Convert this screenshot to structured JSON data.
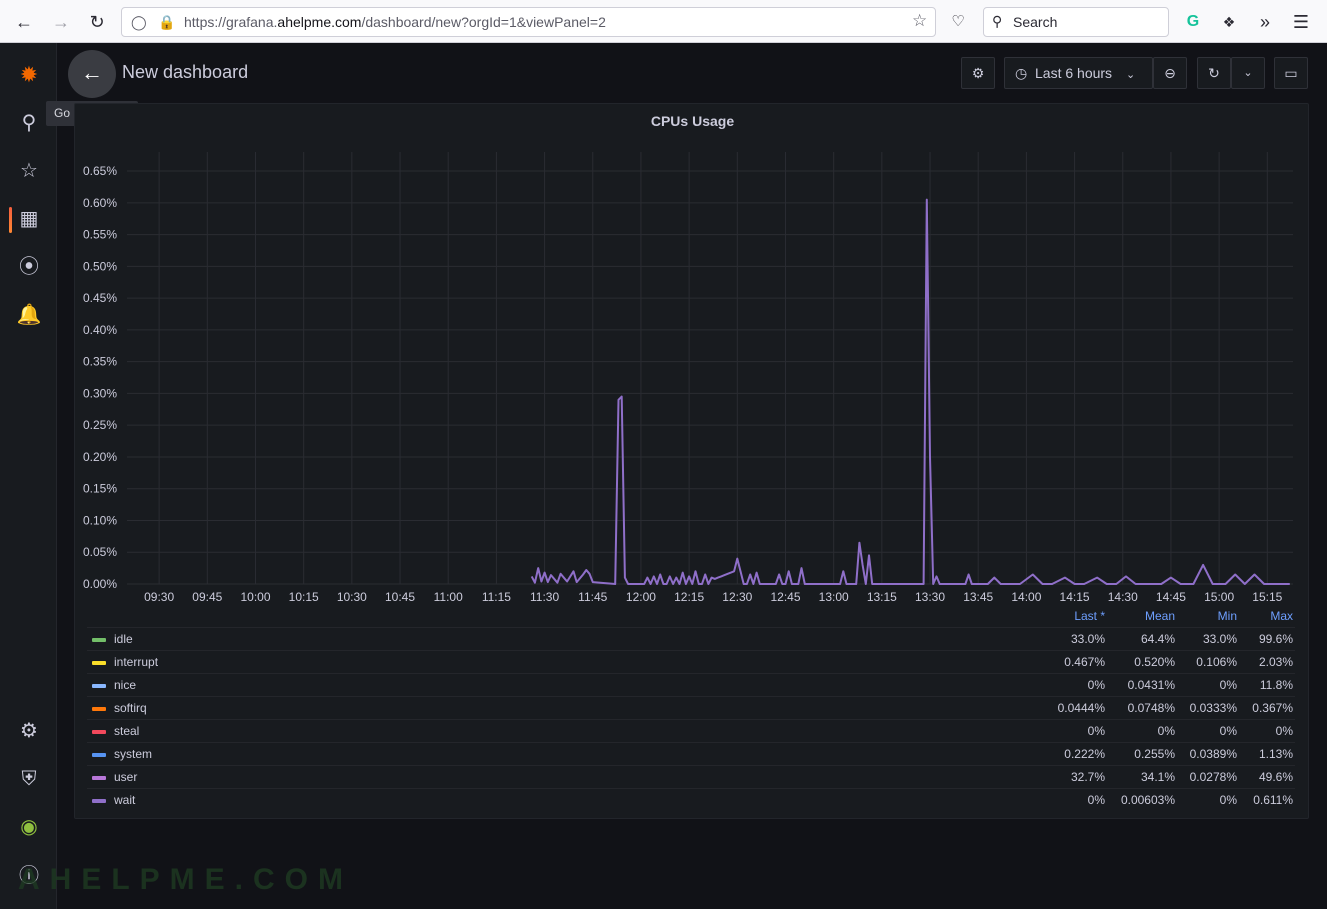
{
  "browser": {
    "url_prefix": "https://grafana.",
    "url_domain": "ahelpme.com",
    "url_suffix": "/dashboard/new?orgId=1&viewPanel=2",
    "search_label": "Search"
  },
  "header": {
    "title": "New dashboard",
    "back_tooltip": "Go back (Esc)",
    "time_range_label": "Last 6 hours"
  },
  "panel": {
    "title": "CPUs Usage"
  },
  "chart_data": {
    "type": "line",
    "title": "CPUs Usage",
    "x_ticks": [
      "09:30",
      "09:45",
      "10:00",
      "10:15",
      "10:30",
      "10:45",
      "11:00",
      "11:15",
      "11:30",
      "11:45",
      "12:00",
      "12:15",
      "12:30",
      "12:45",
      "13:00",
      "13:15",
      "13:30",
      "13:45",
      "14:00",
      "14:15",
      "14:30",
      "14:45",
      "15:00",
      "15:15"
    ],
    "y_ticks": [
      "0.00%",
      "0.05%",
      "0.10%",
      "0.15%",
      "0.20%",
      "0.25%",
      "0.30%",
      "0.35%",
      "0.40%",
      "0.45%",
      "0.50%",
      "0.55%",
      "0.60%",
      "0.65%"
    ],
    "ylim": [
      0,
      0.68
    ],
    "xlim_minutes": [
      560,
      923
    ],
    "grid": true,
    "series_color": "#8f6fc9",
    "series": [
      {
        "name": "wait",
        "x_minutes": [
          686,
          687,
          688,
          689,
          690,
          691,
          692,
          694,
          695,
          697,
          699,
          700,
          702,
          703,
          704,
          705,
          712,
          713,
          714,
          715,
          716,
          721,
          722,
          723,
          724,
          725,
          726,
          727,
          728,
          729,
          730,
          731,
          732,
          733,
          734,
          735,
          736,
          737,
          738,
          739,
          740,
          741,
          742,
          743,
          744,
          745,
          746,
          747,
          748,
          749,
          750,
          751,
          752,
          753,
          754,
          755,
          756,
          757,
          762,
          763,
          764,
          765,
          766,
          767,
          768,
          769,
          770,
          771,
          772,
          773,
          774,
          775,
          776,
          777,
          778,
          779,
          780,
          781,
          782,
          783,
          784,
          785,
          786,
          787,
          788,
          789,
          790,
          791,
          792,
          793,
          797,
          798,
          799,
          800,
          801,
          802,
          803,
          804,
          805,
          807,
          808,
          809,
          810,
          811,
          812,
          813,
          814,
          815,
          816,
          817,
          818,
          820,
          821,
          822,
          823,
          824,
          825,
          826,
          828,
          830,
          832,
          835,
          838,
          842,
          845,
          848,
          852,
          855,
          858,
          862,
          865,
          868,
          871,
          874,
          878,
          882,
          885,
          888,
          892,
          895,
          898,
          902,
          905,
          908,
          911,
          914,
          918,
          921,
          922
        ],
        "values": [
          0.012,
          0.002,
          0.025,
          0.004,
          0.018,
          0.003,
          0.014,
          0.002,
          0.016,
          0.004,
          0.02,
          0.003,
          0.015,
          0.022,
          0.016,
          0.003,
          0.0,
          0.29,
          0.295,
          0.01,
          0.0,
          0.0,
          0.01,
          0.0,
          0.012,
          0.0,
          0.015,
          0.0,
          0.0,
          0.012,
          0.0,
          0.01,
          0.0,
          0.018,
          0.0,
          0.012,
          0.0,
          0.02,
          0.0,
          0.0,
          0.015,
          0.0,
          0.01,
          0.008,
          0.01,
          0.012,
          0.014,
          0.016,
          0.018,
          0.02,
          0.04,
          0.02,
          0.0,
          0.0,
          0.015,
          0.0,
          0.018,
          0.0,
          0.0,
          0.015,
          0.0,
          0.0,
          0.02,
          0.0,
          0.0,
          0.0,
          0.025,
          0.0,
          0.0,
          0.0,
          0.0,
          0.0,
          0.0,
          0.0,
          0.0,
          0.0,
          0.0,
          0.0,
          0.0,
          0.02,
          0.0,
          0.0,
          0.0,
          0.0,
          0.065,
          0.03,
          0.0,
          0.045,
          0.0,
          0.0,
          0.0,
          0.0,
          0.0,
          0.0,
          0.0,
          0.0,
          0.0,
          0.0,
          0.0,
          0.0,
          0.0,
          0.605,
          0.2,
          0.0,
          0.012,
          0.0,
          0.0,
          0.0,
          0.0,
          0.0,
          0.0,
          0.0,
          0.0,
          0.015,
          0.0,
          0.0,
          0.0,
          0.0,
          0.0,
          0.01,
          0.0,
          0.0,
          0.0,
          0.015,
          0.0,
          0.0,
          0.01,
          0.0,
          0.0,
          0.01,
          0.0,
          0.0,
          0.012,
          0.0,
          0.0,
          0.0,
          0.01,
          0.0,
          0.0,
          0.03,
          0.0,
          0.0,
          0.015,
          0.0,
          0.015,
          0.0,
          0.0,
          0.0,
          0.0,
          0.012,
          0.0
        ]
      }
    ]
  },
  "legend": {
    "headers": [
      "Last *",
      "Mean",
      "Min",
      "Max"
    ],
    "rows": [
      {
        "name": "idle",
        "color": "#73bf69",
        "last": "33.0%",
        "mean": "64.4%",
        "min": "33.0%",
        "max": "99.6%"
      },
      {
        "name": "interrupt",
        "color": "#fade2a",
        "last": "0.467%",
        "mean": "0.520%",
        "min": "0.106%",
        "max": "2.03%"
      },
      {
        "name": "nice",
        "color": "#8ab8ff",
        "last": "0%",
        "mean": "0.0431%",
        "min": "0%",
        "max": "11.8%"
      },
      {
        "name": "softirq",
        "color": "#ff780a",
        "last": "0.0444%",
        "mean": "0.0748%",
        "min": "0.0333%",
        "max": "0.367%"
      },
      {
        "name": "steal",
        "color": "#f2495c",
        "last": "0%",
        "mean": "0%",
        "min": "0%",
        "max": "0%"
      },
      {
        "name": "system",
        "color": "#5794f2",
        "last": "0.222%",
        "mean": "0.255%",
        "min": "0.0389%",
        "max": "1.13%"
      },
      {
        "name": "user",
        "color": "#b877d9",
        "last": "32.7%",
        "mean": "34.1%",
        "min": "0.0278%",
        "max": "49.6%"
      },
      {
        "name": "wait",
        "color": "#8f6fc9",
        "last": "0%",
        "mean": "0.00603%",
        "min": "0%",
        "max": "0.611%"
      }
    ]
  },
  "watermark": "AHELPME.COM"
}
